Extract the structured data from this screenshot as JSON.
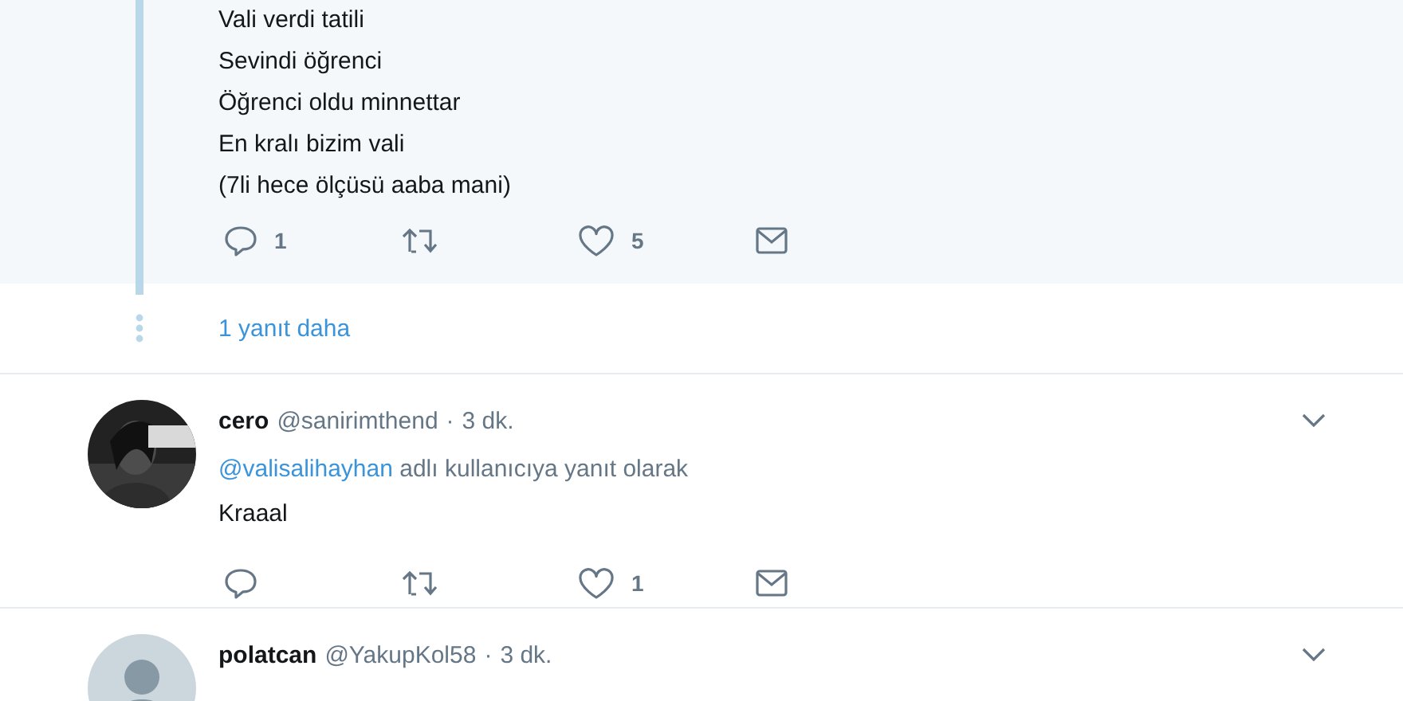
{
  "thread_tail": {
    "lines": [
      "Vali verdi tatili",
      "Sevindi öğrenci",
      "Öğrenci oldu minnettar",
      "En kralı bizim vali",
      "(7li hece ölçüsü aaba mani)"
    ],
    "actions": {
      "replies": "1",
      "likes": "5"
    }
  },
  "more_replies": "1 yanıt daha",
  "tweets": [
    {
      "name": "cero",
      "handle": "@sanirimthend",
      "separator": "·",
      "time": "3 dk.",
      "reply_to": {
        "mention": "@valisalihayhan",
        "text": "adlı kullanıcıya yanıt olarak"
      },
      "text": "Kraaal",
      "actions": {
        "likes": "1"
      }
    },
    {
      "name": "polatcan",
      "handle": "@YakupKol58",
      "separator": "·",
      "time": "3 dk.",
      "avatar": {
        "kind": "default"
      }
    }
  ]
}
